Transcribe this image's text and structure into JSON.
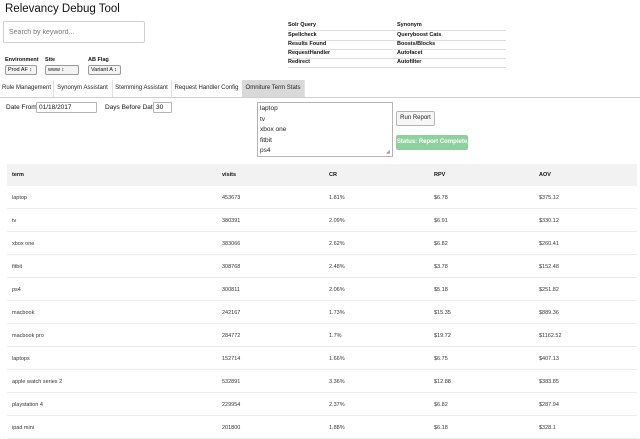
{
  "app": {
    "title": "Relevancy Debug Tool"
  },
  "search": {
    "placeholder": "Search by keyword..."
  },
  "filters": {
    "environment": {
      "label": "Environment",
      "value": "Prod AF ↕"
    },
    "site": {
      "label": "Site",
      "value": "www ↕"
    },
    "ab_flag": {
      "label": "AB Flag",
      "value": "Variant A ↕"
    }
  },
  "info_panel": [
    {
      "key": "Solr Query",
      "value": "Synonym"
    },
    {
      "key": "Spellcheck",
      "value": "Queryboost Cats"
    },
    {
      "key": "Results Found",
      "value": "Boosts/Blocks"
    },
    {
      "key": "RequestHandler",
      "value": "Autofacet"
    },
    {
      "key": "Redirect",
      "value": "Autofilter"
    }
  ],
  "tabs": [
    {
      "label": "Rule Management",
      "active": false
    },
    {
      "label": "Synonym Assistant",
      "active": false
    },
    {
      "label": "Stemming Assistant",
      "active": false
    },
    {
      "label": "Request Handler Config",
      "active": false
    },
    {
      "label": "Omniture Term Stats",
      "active": true
    }
  ],
  "form": {
    "date_from_label": "Date From",
    "date_from_value": "01/18/2017",
    "days_before_label": "Days Before Date",
    "days_before_value": "30",
    "terms_lines": [
      "laptop",
      "tv",
      "xbox one",
      "fitbit",
      "ps4"
    ],
    "run_report_label": "Run Report",
    "status_text": "Status: Report Complete"
  },
  "colors": {
    "status_badge": "#8fd19e",
    "active_tab": "#d9d9d9",
    "header_row": "#f2f2f2"
  },
  "table": {
    "columns": [
      "term",
      "visits",
      "CR",
      "RPV",
      "AOV"
    ],
    "rows": [
      [
        "laptop",
        "453673",
        "1.81%",
        "$6.78",
        "$375.12"
      ],
      [
        "tv",
        "380391",
        "2.09%",
        "$6.91",
        "$330.12"
      ],
      [
        "xbox one",
        "383066",
        "2.62%",
        "$6.82",
        "$260.41"
      ],
      [
        "fitbit",
        "308768",
        "2.48%",
        "$3.78",
        "$152.48"
      ],
      [
        "ps4",
        "300811",
        "2.06%",
        "$5.18",
        "$251.82"
      ],
      [
        "macbook",
        "242167",
        "1.73%",
        "$15.35",
        "$889.36"
      ],
      [
        "macbook pro",
        "284772",
        "1.7%",
        "$19.72",
        "$1162.52"
      ],
      [
        "laptops",
        "152714",
        "1.66%",
        "$6.75",
        "$407.13"
      ],
      [
        "apple watch series 2",
        "532891",
        "3.36%",
        "$12.88",
        "$383.85"
      ],
      [
        "playstation 4",
        "229954",
        "2.37%",
        "$6.82",
        "$287.94"
      ],
      [
        "ipad mini",
        "201800",
        "1.88%",
        "$6.18",
        "$328.1"
      ]
    ]
  }
}
